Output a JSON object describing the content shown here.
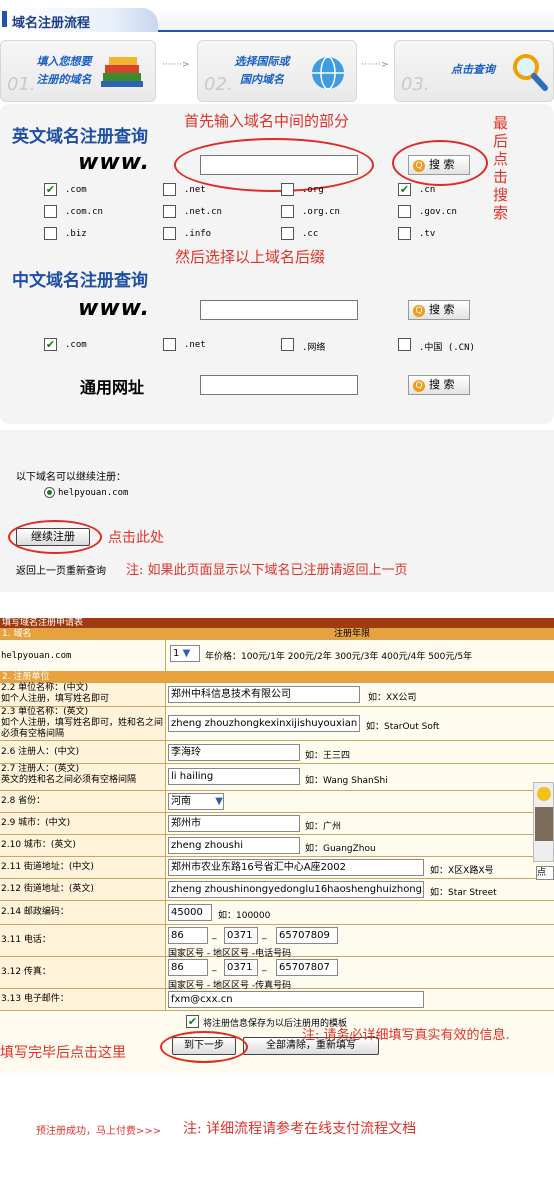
{
  "header": {
    "title": "域名注册流程"
  },
  "steps": [
    {
      "num": "01.",
      "line1": "填入您想要",
      "line2": "注册的域名"
    },
    {
      "num": "02.",
      "line1": "选择国际或",
      "line2": "国内域名"
    },
    {
      "num": "03.",
      "text": "点击查询"
    }
  ],
  "arrow": "·······>",
  "english": {
    "title": "英文域名注册查询",
    "www": "www.",
    "search_label": "搜 索",
    "rows": [
      [
        {
          "label": ".com",
          "checked": true
        },
        {
          "label": ".net",
          "checked": false
        },
        {
          "label": ".org",
          "checked": false
        },
        {
          "label": ".cn",
          "checked": true
        }
      ],
      [
        {
          "label": ".com.cn",
          "checked": false
        },
        {
          "label": ".net.cn",
          "checked": false
        },
        {
          "label": ".org.cn",
          "checked": false
        },
        {
          "label": ".gov.cn",
          "checked": false
        }
      ],
      [
        {
          "label": ".biz",
          "checked": false
        },
        {
          "label": ".info",
          "checked": false
        },
        {
          "label": ".cc",
          "checked": false
        },
        {
          "label": ".tv",
          "checked": false
        }
      ]
    ]
  },
  "chinese": {
    "title": "中文域名注册查询",
    "www": "www.",
    "search_label": "搜 索",
    "row": [
      {
        "label": ".com",
        "checked": true
      },
      {
        "label": ".net",
        "checked": false
      },
      {
        "label": ".网络",
        "checked": false
      },
      {
        "label": ".中国 (.CN)",
        "checked": false
      }
    ]
  },
  "universal": {
    "label": "通用网址",
    "search_label": "搜 索"
  },
  "annot": {
    "a1": "首先输入域名中间的部分",
    "a2": "最后点击搜索",
    "a3": "然后选择以上域名后缀",
    "a4": "点击此处",
    "a5": "注: 如果此页面显示以下域名已注册请返回上一页",
    "a6": "注: 请务必详细填写真实有效的信息.",
    "a7": "填写完毕后点击这里",
    "a8": "注: 详细流程请参考在线支付流程文档"
  },
  "available": {
    "title": "以下域名可以继续注册：",
    "domain": "helpyouan.com",
    "continue": "继续注册",
    "back": "返回上一页重新查询"
  },
  "form": {
    "title": "填写域名注册申请表",
    "h_domain": "1. 域名",
    "h_years": "注册年限",
    "domain": "helpyouan.com",
    "years": "1",
    "price": "年价格：100元/1年 200元/2年 300元/3年 400元/4年 500元/5年",
    "unit_head": "2. 注册单位",
    "l22a": "2.2 单位名称：(中文)",
    "l22b": "如个人注册，填写姓名即可",
    "v22": "郑州中科信息技术有限公司",
    "h22": "如：XX公司",
    "l23a": "2.3 单位名称：(英文)",
    "l23b": "如个人注册，填写姓名即可，姓和名之间必须有空格间隔",
    "v23": "zheng zhouzhongkexinxijishuyouxian",
    "h23": "如：StarOut Soft",
    "l26": "2.6 注册人：(中文)",
    "v26": "李海玲",
    "h26": "如：王三四",
    "l27a": "2.7 注册人：(英文)",
    "l27b": "英文的姓和名之间必须有空格间隔",
    "v27": "li hailing",
    "h27": "如：Wang ShanShi",
    "l28": "2.8 省份：",
    "v28": "河南",
    "l29": "2.9 城市：(中文)",
    "v29": "郑州市",
    "h29": "如：广州",
    "l210": "2.10 城市：(英文)",
    "v210": "zheng zhoushi",
    "h210": "如：GuangZhou",
    "l211": "2.11 街道地址：(中文)",
    "v211": "郑州市农业东路16号省汇中心A座2002",
    "h211": "如：X区X路X号",
    "l212": "2.12 街道地址：(英文)",
    "v212": "zheng zhoushinongyedonglu16haoshenghuizhongxin",
    "h212": "如：Star Street",
    "l214": "2.14 邮政编码：",
    "v214": "45000",
    "h214": "如：100000",
    "l311": "3.11 电话：",
    "tel": [
      "86",
      "0371",
      "65707809"
    ],
    "tel_hint": "国家区号 - 地区区号 -电话号码",
    "l312": "3.12 传真：",
    "fax": [
      "86",
      "0371",
      "65707807"
    ],
    "fax_hint": "国家区号 - 地区区号 -传真号码",
    "l313": "3.13 电子邮件：",
    "v313": "fxm@cxx.cn",
    "save": "将注册信息保存为以后注册用的模板",
    "next": "到下一步",
    "reset": "全部清除，重新填写"
  },
  "footer": {
    "prepay": "预注册成功，马上付费>>>"
  },
  "side": {
    "tag": "点"
  }
}
